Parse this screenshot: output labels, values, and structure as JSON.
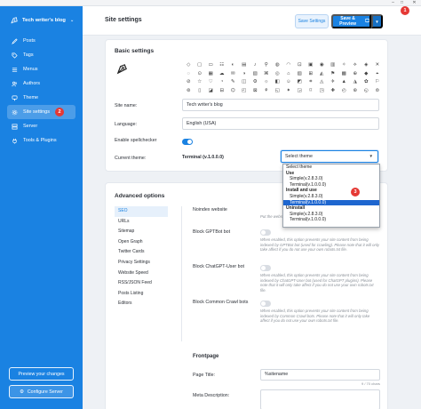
{
  "app": {
    "brand": "Tech writer's blog",
    "badges": {
      "window": "1",
      "site_settings": "2",
      "dropdown": "3"
    }
  },
  "sidebar": {
    "items": [
      {
        "label": "Posts",
        "icon": "pen-icon"
      },
      {
        "label": "Tags",
        "icon": "tag-icon"
      },
      {
        "label": "Menus",
        "icon": "menu-icon"
      },
      {
        "label": "Authors",
        "icon": "users-icon"
      },
      {
        "label": "Theme",
        "icon": "brush-icon"
      },
      {
        "label": "Site settings",
        "icon": "gear-icon",
        "active": true
      },
      {
        "label": "Server",
        "icon": "server-icon"
      },
      {
        "label": "Tools & Plugins",
        "icon": "plug-icon"
      }
    ],
    "preview_label": "Preview your changes",
    "configure_label": "Configure Server"
  },
  "header": {
    "title": "Site settings",
    "save_label": "Save Settings",
    "save_preview_label": "Save & Preview"
  },
  "basic": {
    "title": "Basic settings",
    "site_name_label": "Site name:",
    "site_name_value": "Tech writer's blog",
    "language_label": "Language:",
    "language_value": "English (USA)",
    "spellcheck_label": "Enable spellchecker",
    "spellcheck_on": true,
    "theme_label": "Current theme:",
    "theme_value": "Terminal (v.1.0.0.0)",
    "theme_select_value": "Select theme",
    "theme_options": [
      {
        "label": "Select theme",
        "kind": "option"
      },
      {
        "label": "Use",
        "kind": "group"
      },
      {
        "label": "Simple(v.2.8.3.0)",
        "kind": "sub"
      },
      {
        "label": "Terminal(v.1.0.0.0)",
        "kind": "sub"
      },
      {
        "label": "Install and use",
        "kind": "group"
      },
      {
        "label": "Simple(v.2.8.3.0)",
        "kind": "sub"
      },
      {
        "label": "Terminal(v.1.0.0.0)",
        "kind": "sub",
        "selected": true
      },
      {
        "label": "Uninstall",
        "kind": "group"
      },
      {
        "label": "Simple(v.2.8.3.0)",
        "kind": "sub"
      },
      {
        "label": "Terminal(v.1.0.0.0)",
        "kind": "sub"
      }
    ]
  },
  "advanced": {
    "title": "Advanced options",
    "menu": [
      "SEO",
      "URLs",
      "Sitemap",
      "Open Graph",
      "Twitter Cards",
      "Privacy Settings",
      "Website Speed",
      "RSS/JSON Feed",
      "Posts Listing",
      "Editors"
    ],
    "options": [
      {
        "label": "Noindex website",
        "desc": "Put the website in noindex mode."
      },
      {
        "label": "Block GPTBot bot",
        "desc": "When enabled, this option prevents your site content from being indexed by GPTBot bot (used for crawling). Please note that it will only take affect if you do not use your own robots.txt file."
      },
      {
        "label": "Block ChatGPT-User bot",
        "desc": "When enabled, this option prevents your site content from being indexed by ChatGPT-User bot (used for ChatGPT plugins). Please note that it will only take affect if you do not use your own robots.txt file."
      },
      {
        "label": "Block Common Crawl bots",
        "desc": "When enabled, this option prevents your site content from being indexed by Common Crawl bots. Please note that it will only take affect if you do not use your own robots.txt file."
      }
    ],
    "frontpage_title": "Frontpage",
    "page_title_label": "Page Title:",
    "page_title_value": "%sitename",
    "page_title_counter": "9 / 70 chars",
    "meta_desc_label": "Meta Description:"
  }
}
